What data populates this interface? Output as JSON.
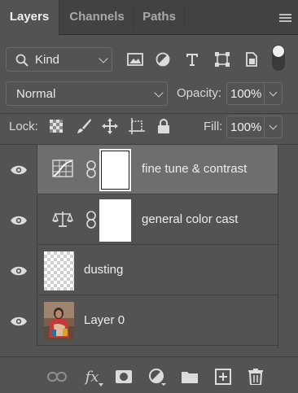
{
  "tabs": [
    {
      "label": "Layers",
      "active": true
    },
    {
      "label": "Channels",
      "active": false
    },
    {
      "label": "Paths",
      "active": false
    }
  ],
  "filter": {
    "kind_label": "Kind",
    "icons": [
      "image-filter-icon",
      "adjustment-filter-icon",
      "type-filter-icon",
      "shape-filter-icon",
      "smart-object-filter-icon"
    ]
  },
  "blend": {
    "mode": "Normal",
    "opacity_label": "Opacity:",
    "opacity_value": "100%"
  },
  "lock": {
    "label": "Lock:",
    "icons": [
      "lock-transparent-pixels-icon",
      "lock-image-pixels-icon",
      "lock-position-icon",
      "lock-artboard-icon",
      "lock-all-icon"
    ],
    "fill_label": "Fill:",
    "fill_value": "100%"
  },
  "layers": [
    {
      "name": "fine tune & contrast",
      "type": "adjustment",
      "adjustment_icon": "curves-icon",
      "selected": true,
      "visible": true
    },
    {
      "name": "general color cast",
      "type": "adjustment",
      "adjustment_icon": "color-balance-icon",
      "selected": false,
      "visible": true
    },
    {
      "name": "dusting",
      "type": "pixel",
      "thumb": "transparent",
      "selected": false,
      "visible": true
    },
    {
      "name": "Layer 0",
      "type": "pixel",
      "thumb": "photo",
      "selected": false,
      "visible": true
    }
  ],
  "bottom_toolbar": [
    "link-layers-icon",
    "fx-icon",
    "add-mask-icon",
    "new-adjustment-icon",
    "new-group-icon",
    "new-layer-icon",
    "delete-icon"
  ],
  "bottom_fx_label": "fx",
  "colors": {
    "panel_bg": "#535353",
    "tab_bar_bg": "#424242",
    "selected_row": "#6e6e6e",
    "text": "#e6e6e6"
  }
}
